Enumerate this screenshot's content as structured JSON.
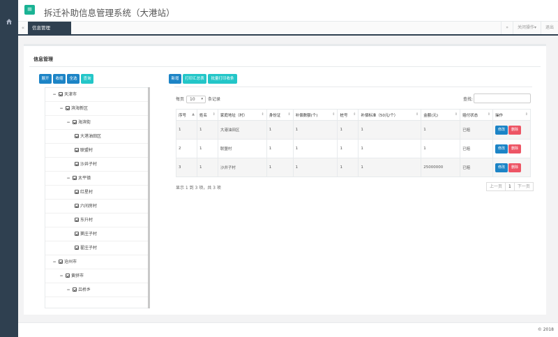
{
  "app": {
    "title": "拆迁补助信息管理系统（大港站）"
  },
  "tabs": {
    "left_arrow": "«",
    "active": "信息管理",
    "right_arrow": "»",
    "close_ops": "关闭操作▾",
    "logout": "退出"
  },
  "section": {
    "title": "信息管理"
  },
  "tree_buttons": {
    "expand": "展开",
    "collapse": "收缩",
    "select_all": "全选",
    "query": "查询"
  },
  "toolbar": {
    "add": "新增",
    "print_summary": "打印汇总表",
    "batch_print": "批量打印收条"
  },
  "tree": [
    {
      "label": "天津市",
      "level": 0
    },
    {
      "label": "滨海新区",
      "level": 1
    },
    {
      "label": "海滨街",
      "level": 2
    },
    {
      "label": "大港油田区",
      "level": 3
    },
    {
      "label": "联盟村",
      "level": 3
    },
    {
      "label": "沙井子村",
      "level": 3
    },
    {
      "label": "太平镇",
      "level": 2
    },
    {
      "label": "红星村",
      "level": 3
    },
    {
      "label": "六间房村",
      "level": 3
    },
    {
      "label": "东升村",
      "level": 3
    },
    {
      "label": "窦庄子村",
      "level": 3
    },
    {
      "label": "翟庄子村",
      "level": 3
    },
    {
      "label": "沧州市",
      "level": 0
    },
    {
      "label": "黄骅市",
      "level": 1
    },
    {
      "label": "吕桥乡",
      "level": 2
    }
  ],
  "controls": {
    "per_page_prefix": "每页",
    "per_page_value": "10",
    "per_page_suffix": "条记录",
    "search_label": "查找:"
  },
  "table": {
    "columns": [
      "序号",
      "姓名",
      "家庭地址（村）",
      "身份证",
      "补偿数额(个)",
      "桩号",
      "补偿标准（50元/个）",
      "金额(元)",
      "赔付状态",
      "操作"
    ],
    "rows": [
      [
        "1",
        "1",
        "大港油田区",
        "1",
        "1",
        "1",
        "1",
        "1",
        "已赔"
      ],
      [
        "2",
        "1",
        "联盟村",
        "1",
        "1",
        "1",
        "1",
        "1",
        "已赔"
      ],
      [
        "3",
        "1",
        "沙井子村",
        "1",
        "1",
        "1",
        "1",
        "25000000",
        "已赔"
      ]
    ],
    "edit_label": "修改",
    "delete_label": "删除"
  },
  "summary": "显示 1 到 3 项，共 3 项",
  "pager": {
    "prev": "上一页",
    "current": "1",
    "next": "下一页"
  },
  "footer": "© 2018",
  "colors": {
    "sidebar": "#2f4050",
    "primary": "#1c84c6",
    "info": "#23c6c8",
    "danger": "#ed5565",
    "menu": "#1ab394"
  }
}
